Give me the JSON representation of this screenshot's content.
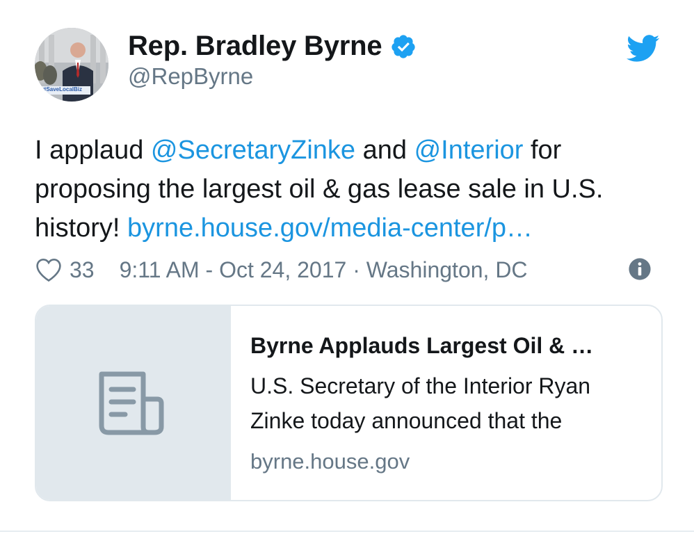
{
  "author": {
    "display_name": "Rep. Bradley Byrne",
    "handle": "@RepByrne",
    "avatar_banner_text": "#SaveLocalBiz"
  },
  "tweet": {
    "text_1": "I applaud ",
    "mention_1": "@SecretaryZinke",
    "text_2": " and ",
    "mention_2": "@Interior",
    "text_3": " for proposing the largest oil & gas lease sale in U.S. history! ",
    "link": "byrne.house.gov/media-center/p…"
  },
  "meta": {
    "like_count": "33",
    "timestamp": "9:11 AM - Oct 24, 2017",
    "separator": " · ",
    "location": "Washington, DC"
  },
  "card": {
    "title": "Byrne Applauds Largest Oil & …",
    "description": "U.S. Secretary of the Interior Ryan Zinke today announced that the",
    "domain": "byrne.house.gov"
  },
  "colors": {
    "accent": "#1b95e0",
    "muted": "#657786",
    "verified": "#1da1f2",
    "card_border": "#e1e8ed"
  },
  "icons": {
    "verified": "verified-badge-icon",
    "brand": "twitter-bird-icon",
    "like": "heart-icon",
    "info": "info-icon",
    "card_placeholder": "document-icon"
  }
}
